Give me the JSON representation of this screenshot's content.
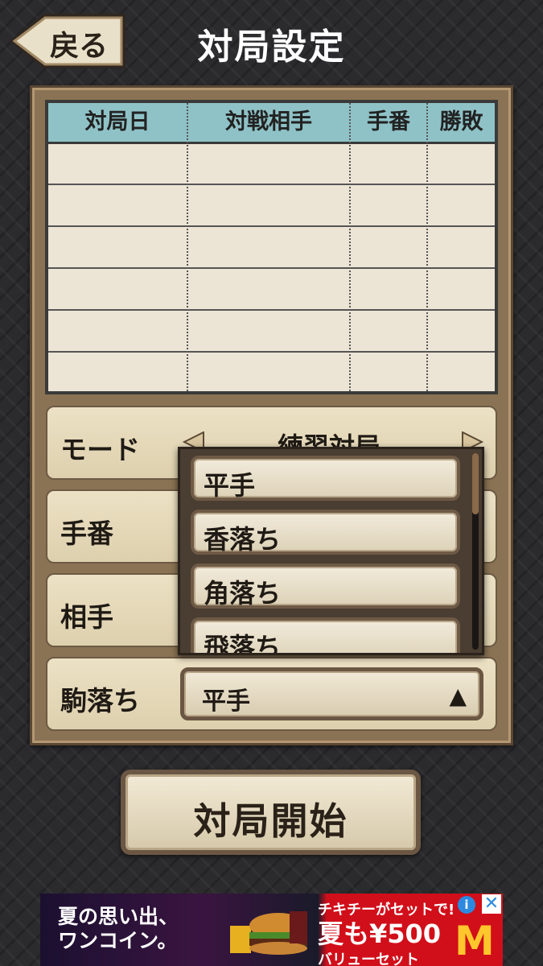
{
  "header": {
    "back_label": "戻る",
    "title": "対局設定"
  },
  "record_table": {
    "columns": [
      "対局日",
      "対戦相手",
      "手番",
      "勝敗"
    ],
    "rows": [
      [
        "",
        "",
        "",
        ""
      ],
      [
        "",
        "",
        "",
        ""
      ],
      [
        "",
        "",
        "",
        ""
      ],
      [
        "",
        "",
        "",
        ""
      ],
      [
        "",
        "",
        "",
        ""
      ],
      [
        "",
        "",
        "",
        ""
      ]
    ]
  },
  "settings": {
    "mode": {
      "label": "モード",
      "value": "練習対局"
    },
    "turn": {
      "label": "手番"
    },
    "opponent": {
      "label": "相手"
    },
    "handicap": {
      "label": "駒落ち",
      "value": "平手",
      "caret": "▲"
    }
  },
  "dropdown": {
    "options": [
      "平手",
      "香落ち",
      "角落ち",
      "飛落ち"
    ]
  },
  "start_button": {
    "label": "対局開始"
  },
  "ad": {
    "left_text_1": "夏の思い出、",
    "left_text_2": "ワンコイン。",
    "line1": "チキチーがセットで!",
    "line2": "夏も¥500",
    "line3": "バリューセット",
    "logo": "M",
    "info": "i",
    "close": "✕"
  },
  "colors": {
    "table_header": "#8fc2c7",
    "panel": "#8a7354",
    "row_bg": "#ece1c4"
  }
}
